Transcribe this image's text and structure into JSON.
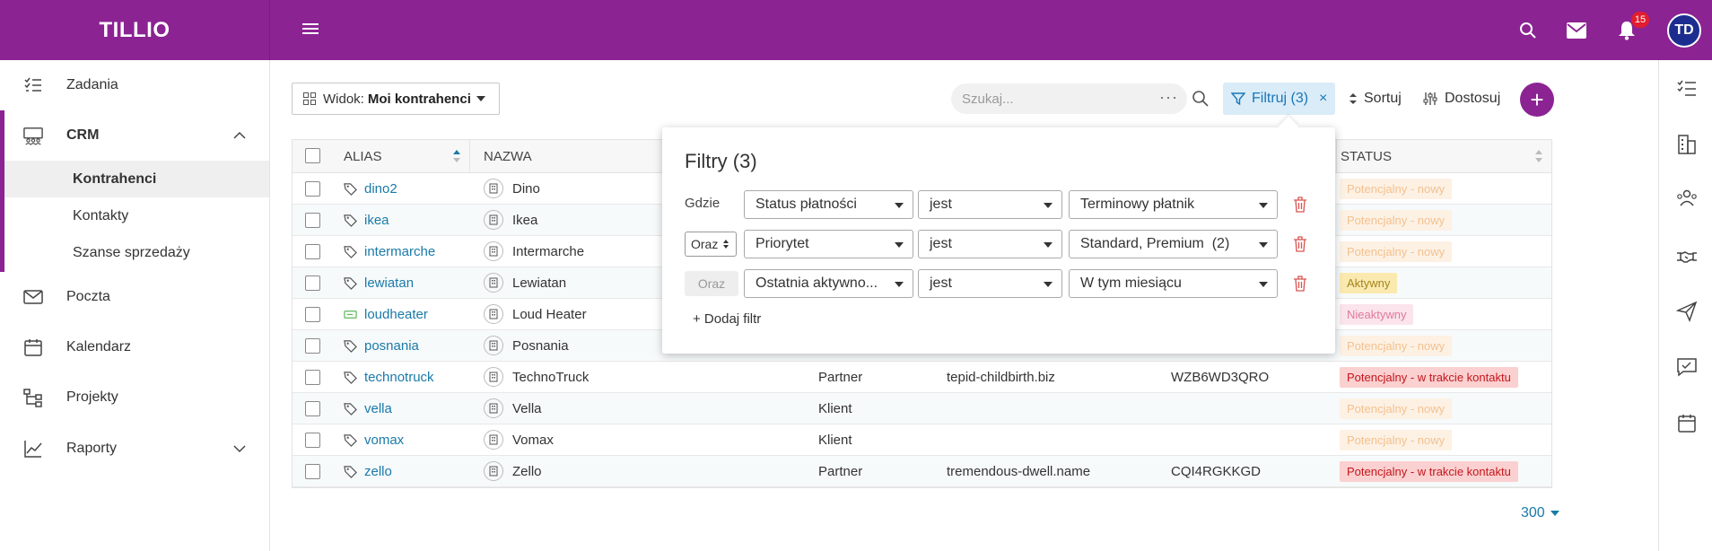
{
  "app": {
    "brand": "TILLIO"
  },
  "header": {
    "notifications_count": "15",
    "avatar_initials": "TD"
  },
  "sidebar": {
    "items": [
      {
        "label": "Zadania"
      },
      {
        "label": "CRM"
      },
      {
        "label": "Poczta"
      },
      {
        "label": "Kalendarz"
      },
      {
        "label": "Projekty"
      },
      {
        "label": "Raporty"
      }
    ],
    "crm_sub": [
      {
        "label": "Kontrahenci"
      },
      {
        "label": "Kontakty"
      },
      {
        "label": "Szanse sprzedaży"
      }
    ]
  },
  "toolbar": {
    "view_prefix": "Widok:",
    "view_name": "Moi kontrahenci",
    "search_placeholder": "Szukaj...",
    "search_more": "···",
    "filter_label": "Filtruj (3)",
    "filter_clear": "×",
    "sort_label": "Sortuj",
    "customize_label": "Dostosuj",
    "add_label": "+"
  },
  "table": {
    "headers": {
      "alias": "ALIAS",
      "name": "NAZWA",
      "status": "STATUS"
    },
    "rows": [
      {
        "alias": "dino2",
        "name": "Dino",
        "type": "",
        "website": "",
        "code": "",
        "status": "Potencjalny - nowy",
        "status_kind": "new",
        "alias_icon": "tag-icon"
      },
      {
        "alias": "ikea",
        "name": "Ikea",
        "type": "",
        "website": "",
        "code": "",
        "status": "Potencjalny - nowy",
        "status_kind": "new",
        "alias_icon": "tag-icon"
      },
      {
        "alias": "intermarche",
        "name": "Intermarche",
        "type": "",
        "website": "",
        "code": "",
        "status": "Potencjalny - nowy",
        "status_kind": "new",
        "alias_icon": "tag-icon"
      },
      {
        "alias": "lewiatan",
        "name": "Lewiatan",
        "type": "",
        "website": "",
        "code": "",
        "status": "Aktywny",
        "status_kind": "active",
        "alias_icon": "tag-icon"
      },
      {
        "alias": "loudheater",
        "name": "Loud Heater",
        "type": "",
        "website": "",
        "code": "",
        "status": "Nieaktywny",
        "status_kind": "inactive",
        "alias_icon": "tag-green-icon"
      },
      {
        "alias": "posnania",
        "name": "Posnania",
        "type": "",
        "website": "",
        "code": "",
        "status": "Potencjalny - nowy",
        "status_kind": "new",
        "alias_icon": "tag-icon"
      },
      {
        "alias": "technotruck",
        "name": "TechnoTruck",
        "type": "Partner",
        "website": "tepid-childbirth.biz",
        "code": "WZB6WD3QRO",
        "status": "Potencjalny - w trakcie kontaktu",
        "status_kind": "contact",
        "alias_icon": "tag-icon"
      },
      {
        "alias": "vella",
        "name": "Vella",
        "type": "Klient",
        "website": "",
        "code": "",
        "status": "Potencjalny - nowy",
        "status_kind": "new",
        "alias_icon": "tag-icon"
      },
      {
        "alias": "vomax",
        "name": "Vomax",
        "type": "Klient",
        "website": "",
        "code": "",
        "status": "Potencjalny - nowy",
        "status_kind": "new",
        "alias_icon": "tag-icon"
      },
      {
        "alias": "zello",
        "name": "Zello",
        "type": "Partner",
        "website": "tremendous-dwell.name",
        "code": "CQI4RGKKGD",
        "status": "Potencjalny - w trakcie kontaktu",
        "status_kind": "contact",
        "alias_icon": "tag-icon"
      }
    ]
  },
  "pager": {
    "page_size": "300"
  },
  "filters_popup": {
    "title": "Filtry (3)",
    "rows": [
      {
        "connector": "Gdzie",
        "field": "Status płatności",
        "operator": "jest",
        "value": "Terminowy płatnik"
      },
      {
        "connector": "Oraz",
        "field": "Priorytet",
        "operator": "jest",
        "value": "Standard, Premium  (2)"
      },
      {
        "connector": "Oraz",
        "field": "Ostatnia aktywno...",
        "operator": "jest",
        "value": "W tym miesiącu"
      }
    ],
    "add_filter_label": "+ Dodaj filtr"
  },
  "colors": {
    "brand": "#8b2393",
    "link": "#1a7aa8",
    "avatar": "#1c2d8f"
  }
}
